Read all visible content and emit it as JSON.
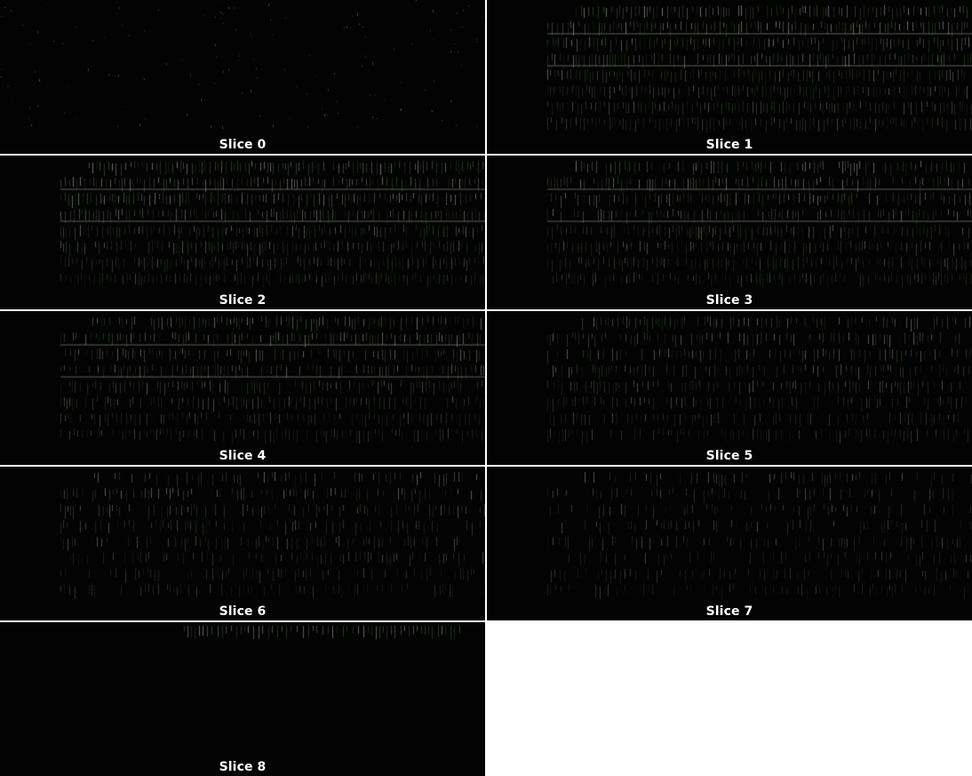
{
  "slices": [
    {
      "label": "Slice 0",
      "density": 0.05,
      "texture": "sparse-dots"
    },
    {
      "label": "Slice 1",
      "density": 0.95,
      "texture": "dense-stripes"
    },
    {
      "label": "Slice 2",
      "density": 0.95,
      "texture": "dense-stripes"
    },
    {
      "label": "Slice 3",
      "density": 0.85,
      "texture": "dense-stripes"
    },
    {
      "label": "Slice 4",
      "density": 0.8,
      "texture": "dense-stripes"
    },
    {
      "label": "Slice 5",
      "density": 0.7,
      "texture": "dense-stripes"
    },
    {
      "label": "Slice 6",
      "density": 0.6,
      "texture": "dense-stripes"
    },
    {
      "label": "Slice 7",
      "density": 0.5,
      "texture": "dense-stripes"
    },
    {
      "label": "Slice 8",
      "density": 0.08,
      "texture": "single-row"
    }
  ],
  "colors": {
    "background": "#030303",
    "frame": "#ffffff",
    "green": "#2f5a23",
    "gray": "#8a8a86",
    "caption": "#ffffff"
  }
}
